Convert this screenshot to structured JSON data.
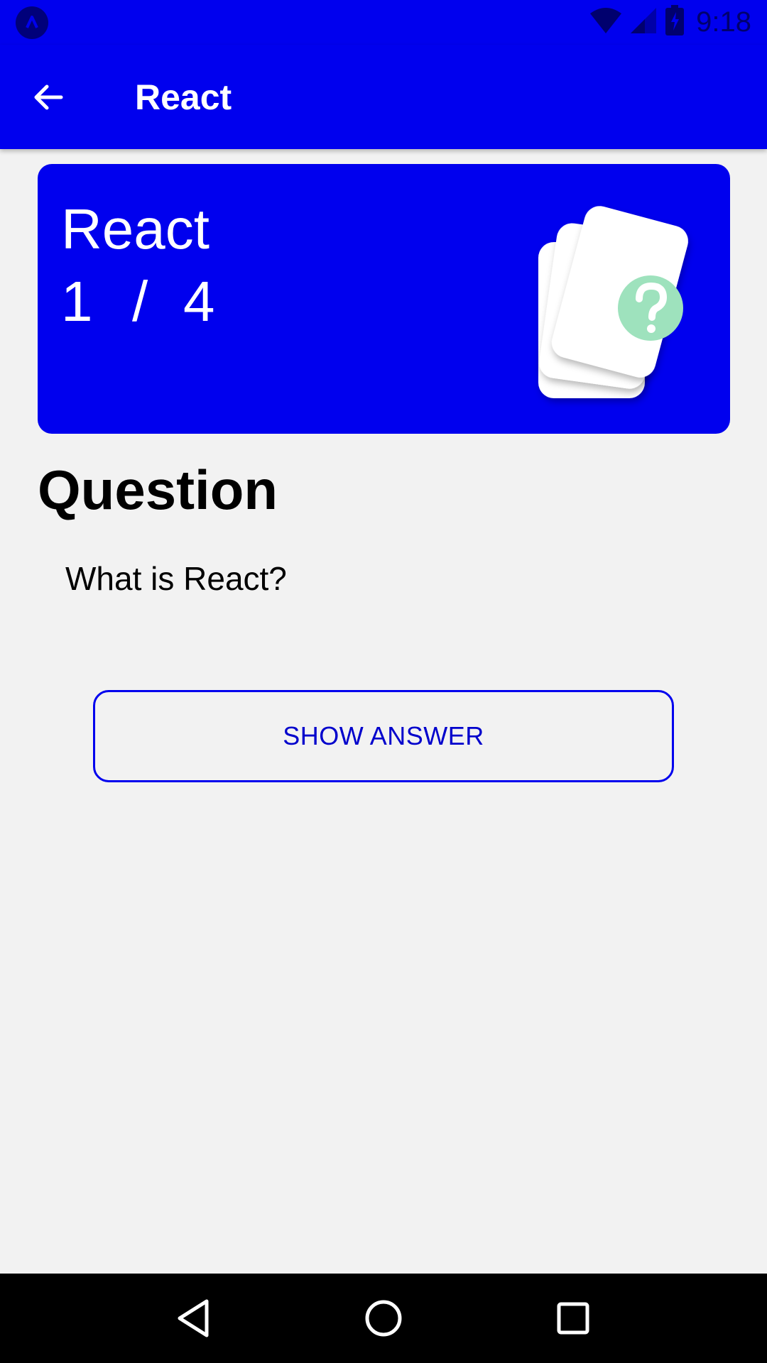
{
  "status_bar": {
    "time": "9:18",
    "icons": [
      "app-notification-icon",
      "wifi-icon",
      "signal-icon",
      "battery-icon"
    ]
  },
  "app_bar": {
    "title": "React",
    "back_icon": "arrow-back-icon"
  },
  "deck": {
    "name": "React",
    "current": "1",
    "separator": "/",
    "total": "4",
    "illustration": "question-cards-icon"
  },
  "question": {
    "heading": "Question",
    "text": "What is React?"
  },
  "actions": {
    "show_answer_label": "SHOW ANSWER"
  },
  "nav_bar": {
    "icons": [
      "back-triangle-icon",
      "home-circle-icon",
      "recents-square-icon"
    ]
  },
  "colors": {
    "primary": "#0000ee",
    "background": "#f2f2f2",
    "accent_question": "#9ee2bd"
  }
}
